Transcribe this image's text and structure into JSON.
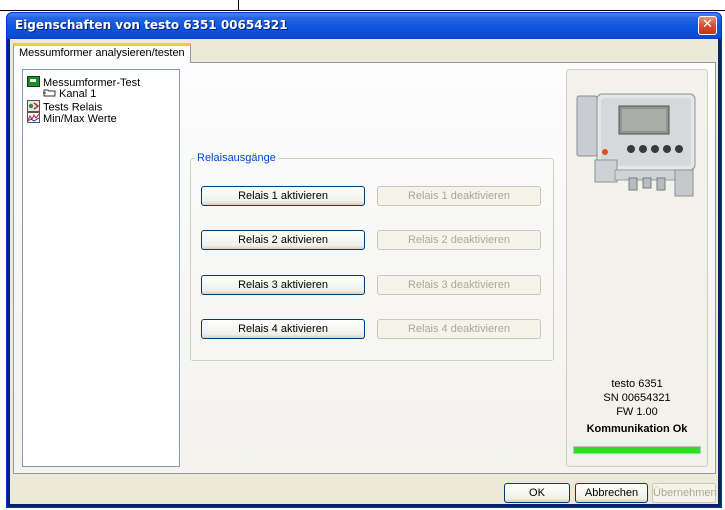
{
  "window": {
    "title": "Eigenschaften von testo 6351  00654321",
    "close_glyph": "✕"
  },
  "background_fragment": "Messumformer analysieren/testen",
  "tab": {
    "label": "Messumformer analysieren/testen"
  },
  "tree": {
    "items": [
      {
        "label": "Messumformer-Test",
        "icon": "transmitter-icon"
      },
      {
        "label": "Kanal 1",
        "icon": "channel-icon"
      },
      {
        "label": "Tests Relais",
        "icon": "relay-icon",
        "selected": true
      },
      {
        "label": "Min/Max Werte",
        "icon": "minmax-chart-icon"
      }
    ]
  },
  "relay_group": {
    "legend": "Relaisausgänge",
    "rows": [
      {
        "activate": "Relais 1 aktivieren",
        "deactivate": "Relais 1 deaktivieren"
      },
      {
        "activate": "Relais 2 aktivieren",
        "deactivate": "Relais 2 deaktivieren"
      },
      {
        "activate": "Relais 3 aktivieren",
        "deactivate": "Relais 3 deaktivieren"
      },
      {
        "activate": "Relais 4 aktivieren",
        "deactivate": "Relais 4 deaktivieren"
      }
    ]
  },
  "device": {
    "model": "testo 6351",
    "serial": "SN 00654321",
    "firmware": "FW  1.00",
    "status": "Kommunikation Ok",
    "progress": 1.0
  },
  "buttons": {
    "ok": "OK",
    "cancel": "Abbrechen",
    "apply": "Übernehmen"
  },
  "colors": {
    "titlebar": "#0a55e0",
    "legend_text": "#0046d5",
    "progress_fill": "#2ddc2d",
    "tab_highlight": "#ffc83c"
  }
}
